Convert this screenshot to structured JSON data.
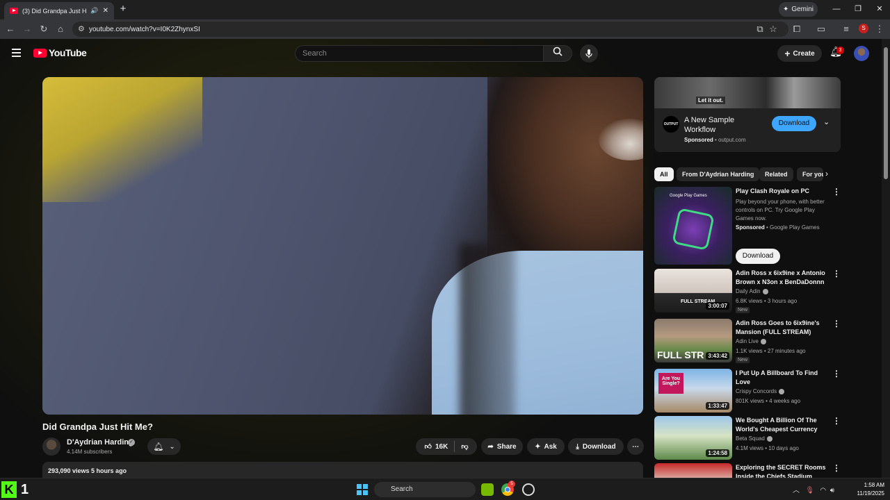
{
  "browser": {
    "tab_title": "(3) Did Grandpa Just Hit Me",
    "url": "youtube.com/watch?v=I0K2ZhynxSI",
    "gemini_label": "Gemini",
    "profile_initial": "S"
  },
  "masthead": {
    "logo_text": "YouTube",
    "search_placeholder": "Search",
    "create_label": "Create",
    "notification_count": "3"
  },
  "video": {
    "title": "Did Grandpa Just Hit Me?",
    "channel_name": "D'Aydrian Harding",
    "subscribers": "4.14M subscribers",
    "like_count": "16K",
    "share_label": "Share",
    "ask_label": "Ask",
    "download_label": "Download",
    "description_meta": "293,090 views  5 hours ago"
  },
  "ad": {
    "banner_text": "Let it out.",
    "logo_text": "OUTPUT",
    "title": "A New Sample Workflow",
    "sponsored": "Sponsored",
    "domain": "output.com",
    "cta": "Download"
  },
  "chips": [
    "All",
    "From D'Aydrian Harding",
    "Related",
    "For you"
  ],
  "recommendations": [
    {
      "title": "Play Clash Royale on PC",
      "description": "Play beyond your phone, with better controls on PC. Try Google Play Games now.",
      "sponsored": "Sponsored",
      "advertiser": "Google Play Games",
      "cta": "Download",
      "thumb_label": "Google Play Games"
    },
    {
      "title": "Adin Ross x 6ix9ine x Antonio Brown x N3on x BenDaDonnn ...",
      "channel": "Daily Adin",
      "meta": "6.8K views • 3 hours ago",
      "duration": "3:00:07",
      "badge": "New",
      "thumb_text": "FULL STREAM"
    },
    {
      "title": "Adin Ross Goes to 6ix9ine's Mansion (FULL STREAM)",
      "channel": "Adin Live",
      "meta": "1.1K views • 27 minutes ago",
      "duration": "3:43:42",
      "badge": "New",
      "thumb_text": "FULL STR"
    },
    {
      "title": "I Put Up A Billboard To Find Love",
      "channel": "Crispy Concords",
      "meta": "801K views • 4 weeks ago",
      "duration": "1:33:47",
      "thumb_text": "Are You Single?"
    },
    {
      "title": "We Bought A Billion Of The World's Cheapest Currency",
      "channel": "Beta Squad",
      "meta": "4.1M views • 10 days ago",
      "duration": "1:24:58"
    },
    {
      "title": "Exploring the SECRET Rooms Inside the Chiefs Stadium"
    }
  ],
  "taskbar": {
    "search_label": "Search",
    "chrome_badge": "5",
    "time": "1:58 AM",
    "date": "11/19/2025",
    "k_logo": "K",
    "k_number": "1"
  },
  "colors": {
    "accent_blue": "#3ea6ff",
    "brand_red": "#ff0033",
    "kick_green": "#53fc18"
  }
}
